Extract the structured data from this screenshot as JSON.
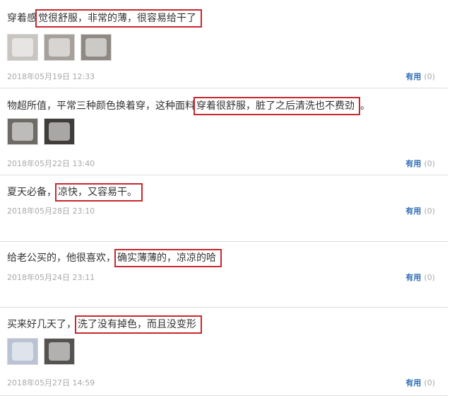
{
  "reviews": [
    {
      "text_before": "穿着感",
      "highlight": "觉很舒服，非常的薄，很容易给干了",
      "text_after": "",
      "thumbnails": [
        {
          "color": "#c9c6c1"
        },
        {
          "color": "#a6a09a"
        },
        {
          "color": "#8e8983"
        }
      ],
      "date": "2018年05月19日 12:33",
      "useful_label": "有用",
      "useful_count": "(0)"
    },
    {
      "text_before": "物超所值，平常三种颜色换着穿，这种面料",
      "highlight": "穿着很舒服，脏了之后清洗也不费劲",
      "text_after": "。",
      "thumbnails": [
        {
          "color": "#6e6a66"
        },
        {
          "color": "#3f3c3a"
        }
      ],
      "date": "2018年05月22日 13:40",
      "useful_label": "有用",
      "useful_count": "(0)"
    },
    {
      "text_before": "夏天必备，",
      "highlight": "凉快，又容易干。",
      "text_after": "",
      "thumbnails": [],
      "date": "2018年05月28日 23:10",
      "useful_label": "有用",
      "useful_count": "(0)"
    },
    {
      "text_before": "给老公买的，他很喜欢，",
      "highlight": "确实薄薄的，凉凉的哈",
      "text_after": "",
      "thumbnails": [],
      "date": "2018年05月24日 23:11",
      "useful_label": "有用",
      "useful_count": "(0)"
    },
    {
      "text_before": "买来好几天了，",
      "highlight": "洗了没有掉色，而且没变形",
      "text_after": "",
      "thumbnails": [
        {
          "color": "#b9c3d4"
        },
        {
          "color": "#55534f"
        }
      ],
      "date": "2018年05月27日 14:59",
      "useful_label": "有用",
      "useful_count": "(0)"
    }
  ]
}
